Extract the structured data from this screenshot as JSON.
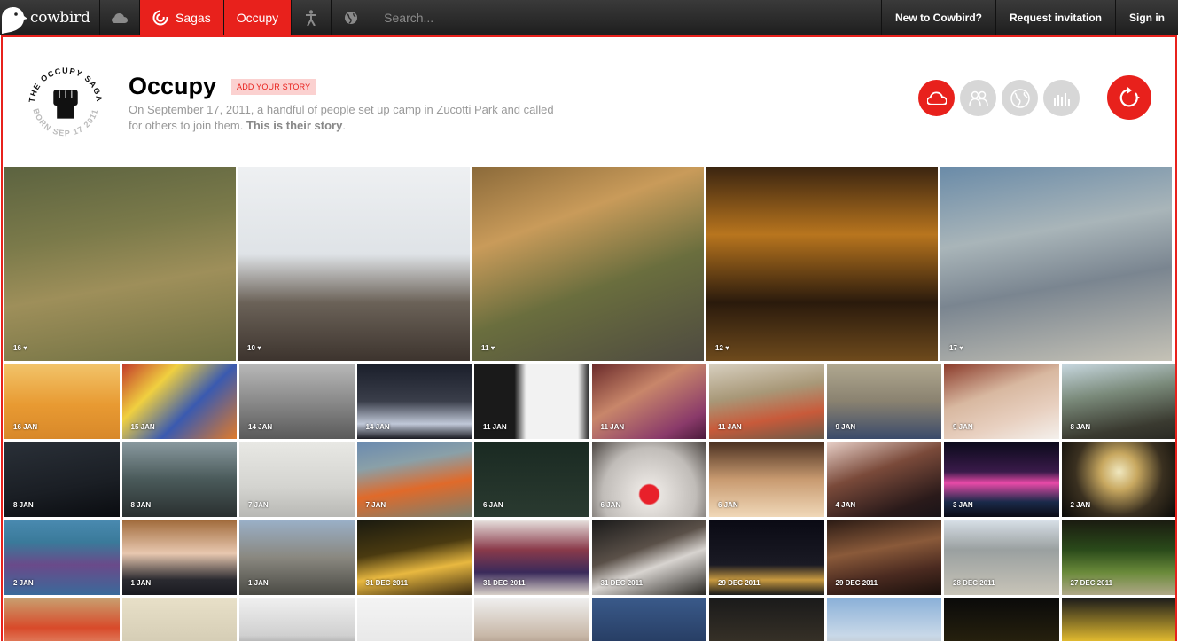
{
  "nav": {
    "brand": "cowbird",
    "tabs": [
      {
        "label": "Sagas"
      },
      {
        "label": "Occupy"
      }
    ],
    "search_placeholder": "Search...",
    "links": [
      "New to Cowbird?",
      "Request invitation",
      "Sign in"
    ]
  },
  "saga": {
    "badge_top_text": "THE OCCUPY SAGA",
    "badge_bottom_text": "BORN SEP 17 2011",
    "title": "Occupy",
    "add_story": "ADD YOUR STORY",
    "description_plain": "On September 17, 2011, a handful of people set up camp in Zucotti Park and called for others to join them. ",
    "description_bold": "This is their story",
    "description_end": "."
  },
  "toolbar": {
    "icons": [
      "cloud-icon",
      "people-icon",
      "globe-icon",
      "bar-chart-icon"
    ],
    "replay_icon": "replay-icon"
  },
  "colors": {
    "accent": "#e8211c",
    "tool_inactive": "#d7d7d7"
  },
  "featured": [
    {
      "label": "16 ♥",
      "bg": "linear-gradient(170deg,#5c6340 0%,#7b7a4a 35%,#9e8f5a 60%,#6f7042 100%)"
    },
    {
      "label": "10 ♥",
      "bg": "linear-gradient(180deg,#eef0f2 0%,#dfe3e7 45%,#6b6258 70%,#3d342e 100%)"
    },
    {
      "label": "11 ♥",
      "bg": "linear-gradient(160deg,#8b6a3a 0%,#c99b5a 30%,#6a6e3e 60%,#4e4a40 100%)"
    },
    {
      "label": "12 ♥",
      "bg": "linear-gradient(180deg,#3a2410 0%,#b8751e 35%,#2a1a0c 70%,#6e4a1c 100%)"
    },
    {
      "label": "17 ♥",
      "bg": "linear-gradient(170deg,#6a8ba8 0%,#a9b5b9 35%,#7a8590 60%,#c5c2b6 100%)"
    }
  ],
  "rows": [
    [
      {
        "label": "16 JAN",
        "bg": "linear-gradient(180deg,#f2c46a 0%,#e89a32 55%,#d8882a 100%)"
      },
      {
        "label": "15 JAN",
        "bg": "linear-gradient(135deg,#c23a2a 0%,#f0d040 30%,#3a5ab0 60%,#e07a2a 100%)"
      },
      {
        "label": "14 JAN",
        "bg": "linear-gradient(180deg,#b8b8b8 0%,#8a8a8a 50%,#5a5a5a 100%)"
      },
      {
        "label": "14 JAN",
        "bg": "linear-gradient(180deg,#1a1e2a 0%,#3a3e4a 50%,#c0c8d8 80%,#1a1a22 100%)"
      },
      {
        "label": "11 JAN",
        "bg": "linear-gradient(90deg,#1a1a1a 0%,#1a1a1a 35%,#f2f2f2 45%,#f2f2f2 90%,#222 100%)"
      },
      {
        "label": "11 JAN",
        "bg": "linear-gradient(150deg,#6a2a2a 0%,#c8866a 40%,#8a3a6a 80%,#4a1a3a 100%)"
      },
      {
        "label": "11 JAN",
        "bg": "linear-gradient(170deg,#d8d0c0 0%,#a89878 40%,#c85a3a 70%,#6a5a48 100%)"
      },
      {
        "label": "9 JAN",
        "bg": "linear-gradient(180deg,#b0a890 0%,#8a8270 50%,#3a4a6a 100%)"
      },
      {
        "label": "9 JAN",
        "bg": "linear-gradient(160deg,#8a3a2a 0%,#d8b8a0 40%,#e8d0c0 70%,#f4f0ec 100%)"
      },
      {
        "label": "8 JAN",
        "bg": "linear-gradient(170deg,#c8d8e0 0%,#7a8a7a 40%,#3a3a30 80%,#2a2a24 100%)"
      }
    ],
    [
      {
        "label": "8 JAN",
        "bg": "linear-gradient(170deg,#2a3038 0%,#1a1e24 60%,#0a0c10 100%)"
      },
      {
        "label": "8 JAN",
        "bg": "linear-gradient(180deg,#8a9aa0 0%,#4a5a5a 50%,#2a3030 100%)"
      },
      {
        "label": "7 JAN",
        "bg": "linear-gradient(180deg,#e8e8e4 0%,#d4d4d0 60%,#b8b8b4 100%)"
      },
      {
        "label": "7 JAN",
        "bg": "linear-gradient(170deg,#6a8ab0 0%,#8aa0a8 30%,#e06a2a 60%,#7a8070 100%)"
      },
      {
        "label": "6 JAN",
        "bg": "linear-gradient(180deg,#1a2a22 0%,#2a3a30 100%)"
      },
      {
        "label": "6 JAN",
        "bg": "radial-gradient(circle at 50% 70%,#e8202a 0%,#e8202a 12%,#e8e4e0 14%,#c0bcb8 60%,#4a4440 100%)"
      },
      {
        "label": "6 JAN",
        "bg": "linear-gradient(180deg,#4a3020 0%,#c89a70 50%,#f0d8b8 100%)"
      },
      {
        "label": "4 JAN",
        "bg": "linear-gradient(160deg,#e8d0c8 0%,#7a4a3a 40%,#2a1a1a 80%,#1a1418 100%)"
      },
      {
        "label": "3 JAN",
        "bg": "linear-gradient(180deg,#0a0a1a 0%,#3a1a4a 40%,#e84aa8 55%,#1a2a4a 80%,#0a0a14 100%)"
      },
      {
        "label": "2 JAN",
        "bg": "radial-gradient(circle at 50% 40%,#f0e8c0 0%,#c8a860 25%,#3a3020 60%,#0a0a08 100%)"
      }
    ],
    [
      {
        "label": "2 JAN",
        "bg": "linear-gradient(180deg,#4a8ab0 0%,#3a7a9a 30%,#6a4a8a 60%,#3a6a9a 100%)"
      },
      {
        "label": "1 JAN",
        "bg": "linear-gradient(180deg,#a06a3a 0%,#e8c8b0 45%,#2a2a30 80%,#1a1a20 100%)"
      },
      {
        "label": "1 JAN",
        "bg": "linear-gradient(180deg,#9ab0c8 0%,#8a8880 50%,#4a4a44 100%)"
      },
      {
        "label": "31 DEC 2011",
        "bg": "linear-gradient(170deg,#1a1a10 0%,#4a3a10 40%,#e8b840 65%,#3a2a10 100%)"
      },
      {
        "label": "31 DEC 2011",
        "bg": "linear-gradient(180deg,#e8e4e0 0%,#8a3a4a 40%,#3a2a5a 70%,#d8d0c8 100%)"
      },
      {
        "label": "31 DEC 2011",
        "bg": "linear-gradient(160deg,#1a1a1a 0%,#5a5048 40%,#d8d4d0 60%,#2a2824 100%)"
      },
      {
        "label": "29 DEC 2011",
        "bg": "linear-gradient(180deg,#0a0a14 0%,#1a1a24 60%,#c89a40 80%,#1a1a1a 100%)"
      },
      {
        "label": "29 DEC 2011",
        "bg": "linear-gradient(170deg,#2a1a14 0%,#8a5a3a 40%,#4a2a20 70%,#1a100c 100%)"
      },
      {
        "label": "28 DEC 2011",
        "bg": "linear-gradient(180deg,#d8e0e8 0%,#9aa0a0 40%,#c8c4b8 100%)"
      },
      {
        "label": "27 DEC 2011",
        "bg": "linear-gradient(180deg,#1a1a10 0%,#2a4a1a 40%,#6a8a3a 70%,#b0a888 100%)"
      }
    ],
    [
      {
        "label": "",
        "bg": "linear-gradient(180deg,#c8a070 0%,#d84a2a 40%,#f0e0c0 100%)"
      },
      {
        "label": "",
        "bg": "linear-gradient(180deg,#e8e0c8 0%,#c8c0a8 100%)"
      },
      {
        "label": "",
        "bg": "linear-gradient(180deg,#f0f0f0 0%,#d0d0d0 50%,#3a3a3a 100%)"
      },
      {
        "label": "",
        "bg": "linear-gradient(180deg,#f4f4f4 0%,#e8e8e8 60%,#e0503a 100%)"
      },
      {
        "label": "",
        "bg": "linear-gradient(180deg,#f0f0f0 0%,#c8b8a8 50%,#6a4a3a 100%)"
      },
      {
        "label": "",
        "bg": "linear-gradient(180deg,#3a5a8a 0%,#1a2a4a 100%)"
      },
      {
        "label": "",
        "bg": "linear-gradient(180deg,#1a1a1a 0%,#4a4030 100%)"
      },
      {
        "label": "",
        "bg": "linear-gradient(180deg,#8ab0d8 0%,#c8d8e8 50%,#b8a890 100%)"
      },
      {
        "label": "",
        "bg": "linear-gradient(180deg,#0a0a0a 0%,#3a3010 100%)"
      },
      {
        "label": "",
        "bg": "linear-gradient(180deg,#1a1a1a 0%,#e8c030 60%,#2a2a1a 100%)"
      }
    ]
  ]
}
